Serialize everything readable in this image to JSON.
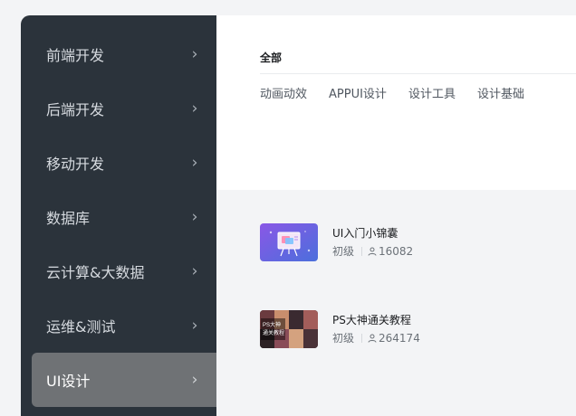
{
  "sidebar": {
    "items": [
      {
        "label": "前端开发",
        "active": false
      },
      {
        "label": "后端开发",
        "active": false
      },
      {
        "label": "移动开发",
        "active": false
      },
      {
        "label": "数据库",
        "active": false
      },
      {
        "label": "云计算&大数据",
        "active": false
      },
      {
        "label": "运维&测试",
        "active": false
      },
      {
        "label": "UI设计",
        "active": true
      }
    ],
    "chevron": "›"
  },
  "filter": {
    "all_label": "全部",
    "tags": [
      "动画动效",
      "APPUI设计",
      "设计工具",
      "设计基础"
    ]
  },
  "courses": [
    {
      "title": "UI入门小锦囊",
      "level": "初级",
      "learners": "16082",
      "thumb_icon": "easel-icon"
    },
    {
      "title": "PS大神通关教程",
      "level": "初级",
      "learners": "264174",
      "thumb_icon": "photo-collage-icon",
      "thumb_text_1": "PS大神",
      "thumb_text_2": "通关教程"
    }
  ]
}
